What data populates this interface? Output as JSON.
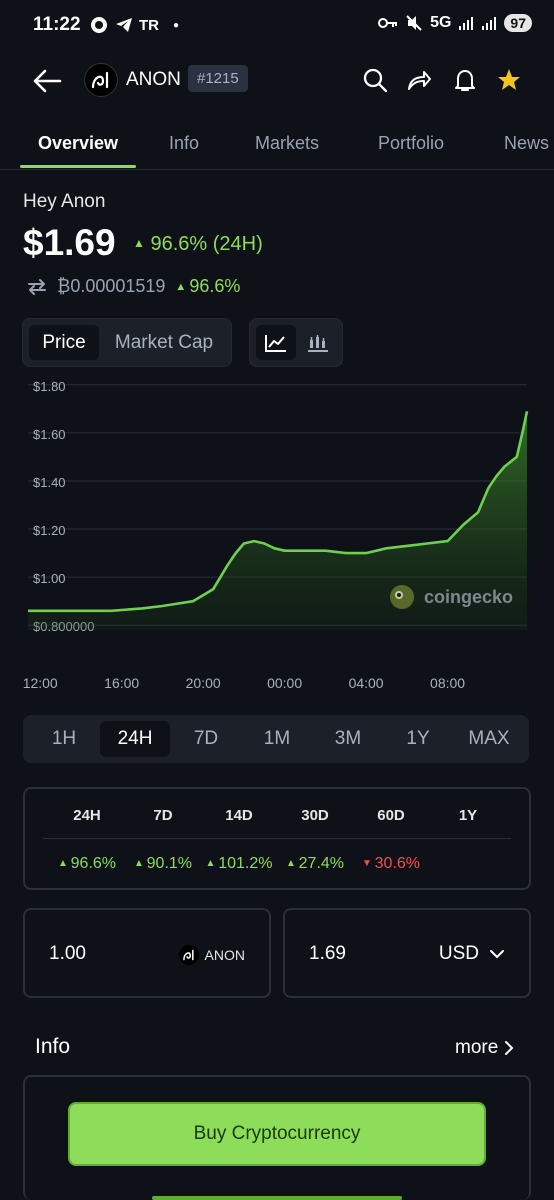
{
  "status_bar": {
    "time": "11:22",
    "carrier_tag": "TR",
    "network": "5G",
    "battery": "97"
  },
  "header": {
    "coin_name": "ANON",
    "rank": "#1215",
    "icons": [
      "back-arrow-icon",
      "search-icon",
      "share-icon",
      "bell-icon",
      "star-icon"
    ]
  },
  "tabs": [
    "Overview",
    "Info",
    "Markets",
    "Portfolio",
    "News"
  ],
  "active_tab": "Overview",
  "coin": {
    "title": "Hey Anon",
    "price": "$1.69",
    "change_24h": "96.6% (24H)",
    "btc_price": "₿0.00001519",
    "btc_change": "96.6%"
  },
  "chart_toggle": {
    "price": "Price",
    "market_cap": "Market Cap"
  },
  "chart_data": {
    "type": "area",
    "title": "",
    "xlabel": "",
    "ylabel": "",
    "y_ticks": [
      "$1.80",
      "$1.60",
      "$1.40",
      "$1.20",
      "$1.00",
      "$0.800000"
    ],
    "y_tick_values": [
      1.8,
      1.6,
      1.4,
      1.2,
      1.0,
      0.8
    ],
    "x_ticks": [
      "12:00",
      "16:00",
      "20:00",
      "00:00",
      "04:00",
      "08:00"
    ],
    "x_tick_hours": [
      0,
      4,
      8,
      12,
      16,
      20
    ],
    "ylim": [
      0.78,
      1.82
    ],
    "xlim_hours": [
      -0.6,
      23.9
    ],
    "series": [
      {
        "hours": [
          -0.6,
          0.5,
          2,
          3.5,
          5,
          6,
          7.5,
          8.5,
          9.2,
          9.6,
          10,
          10.5,
          11,
          11.5,
          12,
          13,
          14,
          15,
          16,
          17,
          18,
          19,
          20,
          20.8,
          21.5,
          22,
          22.4,
          22.8,
          23.1,
          23.4,
          23.7,
          23.9
        ],
        "values": [
          0.86,
          0.86,
          0.86,
          0.86,
          0.87,
          0.88,
          0.9,
          0.95,
          1.05,
          1.1,
          1.14,
          1.15,
          1.14,
          1.12,
          1.11,
          1.11,
          1.11,
          1.1,
          1.1,
          1.12,
          1.13,
          1.14,
          1.15,
          1.22,
          1.27,
          1.37,
          1.42,
          1.46,
          1.48,
          1.5,
          1.61,
          1.69
        ]
      }
    ],
    "line_color": "#6fcf4f",
    "grid": true,
    "watermark": "coingecko"
  },
  "timeframes": [
    "1H",
    "24H",
    "7D",
    "1M",
    "3M",
    "1Y",
    "MAX"
  ],
  "active_timeframe": "24H",
  "performance": {
    "headers": [
      "24H",
      "7D",
      "14D",
      "30D",
      "60D",
      "1Y"
    ],
    "values": [
      {
        "text": "96.6%",
        "dir": "up"
      },
      {
        "text": "90.1%",
        "dir": "up"
      },
      {
        "text": "101.2%",
        "dir": "up"
      },
      {
        "text": "27.4%",
        "dir": "up"
      },
      {
        "text": "30.6%",
        "dir": "down"
      }
    ]
  },
  "converter": {
    "coin_amount": "1.00",
    "coin_unit": "ANON",
    "fiat_amount": "1.69",
    "fiat_unit": "USD"
  },
  "info_section": {
    "title": "Info",
    "more": "more"
  },
  "buy_button": "Buy Cryptocurrency"
}
